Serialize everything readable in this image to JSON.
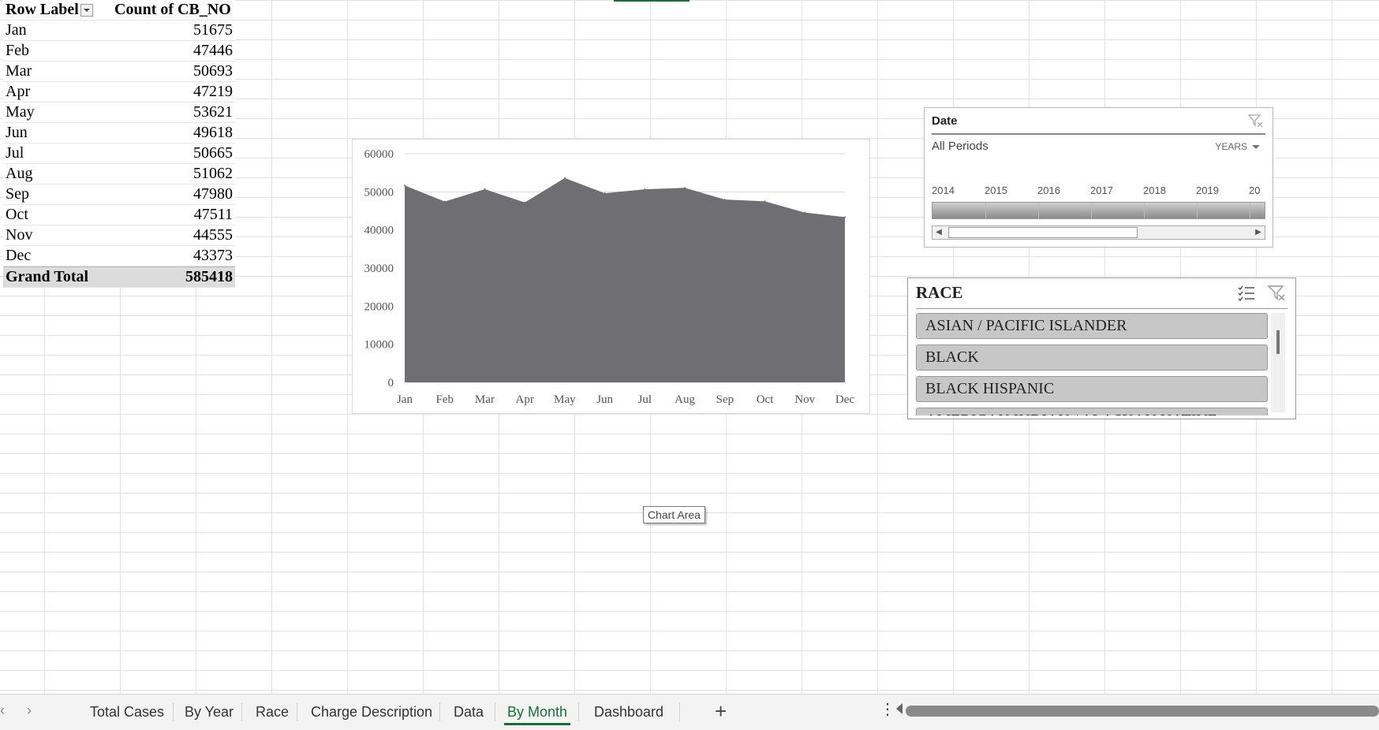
{
  "pivot": {
    "header_row_label": "Row Label",
    "header_count": "Count of CB_NO",
    "rows": [
      {
        "label": "Jan",
        "value": "51675"
      },
      {
        "label": "Feb",
        "value": "47446"
      },
      {
        "label": "Mar",
        "value": "50693"
      },
      {
        "label": "Apr",
        "value": "47219"
      },
      {
        "label": "May",
        "value": "53621"
      },
      {
        "label": "Jun",
        "value": "49618"
      },
      {
        "label": "Jul",
        "value": "50665"
      },
      {
        "label": "Aug",
        "value": "51062"
      },
      {
        "label": "Sep",
        "value": "47980"
      },
      {
        "label": "Oct",
        "value": "47511"
      },
      {
        "label": "Nov",
        "value": "44555"
      },
      {
        "label": "Dec",
        "value": "43373"
      }
    ],
    "total_label": "Grand Total",
    "total_value": "585418"
  },
  "chart_data": {
    "type": "area",
    "categories": [
      "Jan",
      "Feb",
      "Mar",
      "Apr",
      "May",
      "Jun",
      "Jul",
      "Aug",
      "Sep",
      "Oct",
      "Nov",
      "Dec"
    ],
    "values": [
      51675,
      47446,
      50693,
      47219,
      53621,
      49618,
      50665,
      51062,
      47980,
      47511,
      44555,
      43373
    ],
    "ylim": [
      0,
      60000
    ],
    "yticks": [
      "0",
      "10000",
      "20000",
      "30000",
      "40000",
      "50000",
      "60000"
    ],
    "color": "#6f6e72",
    "grid": true,
    "title": "",
    "xlabel": "",
    "ylabel": ""
  },
  "tooltip": "Chart Area",
  "date_slicer": {
    "title": "Date",
    "period": "All Periods",
    "level": "YEARS",
    "years": [
      "2014",
      "2015",
      "2016",
      "2017",
      "2018",
      "2019",
      "20"
    ]
  },
  "race_slicer": {
    "title": "RACE",
    "items": [
      "ASIAN / PACIFIC ISLANDER",
      "BLACK",
      "BLACK HISPANIC"
    ],
    "partial_item": "AMERICAN INDIAN / ALASKAN NATIVE"
  },
  "tabs": {
    "items": [
      "Total Cases",
      "By Year",
      "Race",
      "Charge Description",
      "Data",
      "By Month",
      "Dashboard"
    ],
    "active": "By Month",
    "plus": "+",
    "more": "⋮"
  }
}
